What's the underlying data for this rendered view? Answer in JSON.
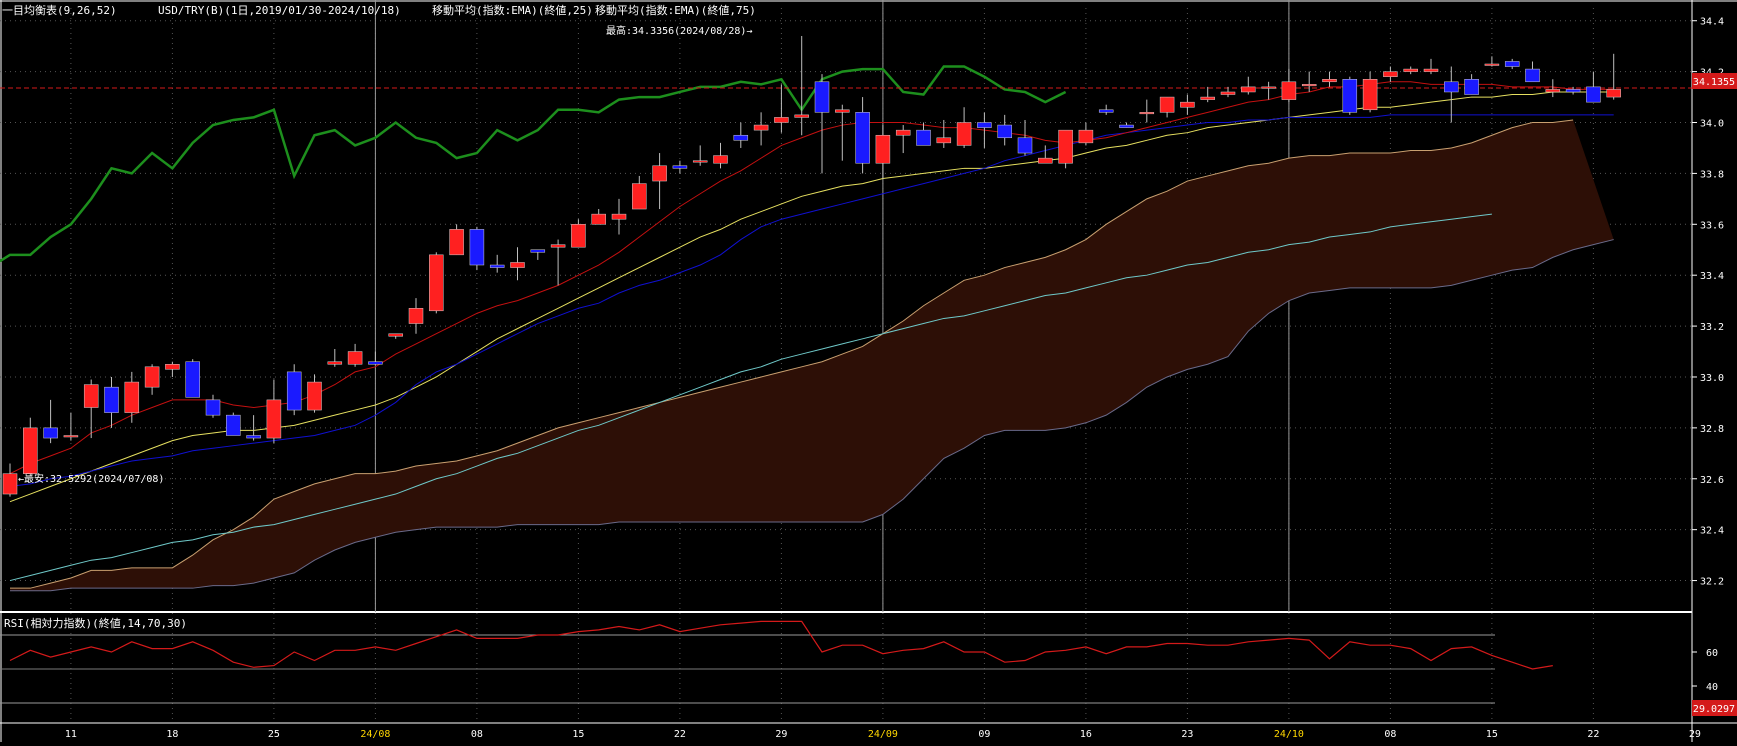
{
  "header": {
    "legend_ichimoku": "一目均衡表(9,26,52)",
    "legend_symbol": "USD/TRY(B)(1日,2019/01/30-2024/10/18)",
    "legend_ema25": "移動平均(指数:EMA)(終値,25)",
    "legend_ema75": "移動平均(指数:EMA)(終値,75)"
  },
  "annotations": {
    "high_label": "最高:34.3356(2024/08/28)→",
    "low_label": "←最安:32.5292(2024/07/08)",
    "last_price_tag": "34.1355",
    "rsi_value_tag": "29.0297"
  },
  "rsi_panel": {
    "title": "RSI(相対力指数)(終値,14,70,30)",
    "ticks": [
      "60",
      "40"
    ],
    "upper": 70,
    "mid": 50,
    "lower": 30
  },
  "colors": {
    "bg": "#000000",
    "up_candle": "#ff2020",
    "down_candle": "#1a1aff",
    "chikou": "#1d8f1d",
    "tenkan": "#c41010",
    "kijun": "#1010d0",
    "ema25": "#e6e060",
    "ema75": "#6fc9c9",
    "cloud": "#2d0f06",
    "last_line": "#d41a1a"
  },
  "chart_data": {
    "type": "candlestick",
    "ylim": [
      32.1,
      34.45
    ],
    "y_ticks": [
      "34.4",
      "34.2",
      "34.0",
      "33.8",
      "33.6",
      "33.4",
      "33.2",
      "33.0",
      "32.8",
      "32.6",
      "32.4",
      "32.2"
    ],
    "x_ticks": [
      {
        "label": "11",
        "highlight": false
      },
      {
        "label": "18",
        "highlight": false
      },
      {
        "label": "25",
        "highlight": false
      },
      {
        "label": "24/08",
        "highlight": true
      },
      {
        "label": "08",
        "highlight": false
      },
      {
        "label": "15",
        "highlight": false
      },
      {
        "label": "22",
        "highlight": false
      },
      {
        "label": "29",
        "highlight": false
      },
      {
        "label": "24/09",
        "highlight": true
      },
      {
        "label": "09",
        "highlight": false
      },
      {
        "label": "16",
        "highlight": false
      },
      {
        "label": "23",
        "highlight": false
      },
      {
        "label": "24/10",
        "highlight": true
      },
      {
        "label": "08",
        "highlight": false
      },
      {
        "label": "15",
        "highlight": false
      },
      {
        "label": "22",
        "highlight": false
      },
      {
        "label": "29",
        "highlight": false
      }
    ],
    "candles": [
      [
        32.54,
        32.66,
        32.53,
        32.62
      ],
      [
        32.62,
        32.84,
        32.61,
        32.8
      ],
      [
        32.8,
        32.91,
        32.74,
        32.76
      ],
      [
        32.77,
        32.86,
        32.75,
        32.77
      ],
      [
        32.88,
        32.99,
        32.76,
        32.97
      ],
      [
        32.96,
        33.0,
        32.8,
        32.86
      ],
      [
        32.86,
        33.02,
        32.82,
        32.98
      ],
      [
        32.96,
        33.05,
        32.93,
        33.04
      ],
      [
        33.03,
        33.06,
        33.0,
        33.05
      ],
      [
        33.06,
        33.07,
        32.97,
        32.92
      ],
      [
        32.91,
        32.93,
        32.84,
        32.85
      ],
      [
        32.85,
        32.86,
        32.78,
        32.77
      ],
      [
        32.77,
        32.85,
        32.75,
        32.76
      ],
      [
        32.76,
        32.99,
        32.74,
        32.91
      ],
      [
        33.02,
        33.05,
        32.85,
        32.87
      ],
      [
        32.87,
        33.01,
        32.86,
        32.98
      ],
      [
        33.05,
        33.11,
        33.04,
        33.06
      ],
      [
        33.05,
        33.13,
        33.04,
        33.1
      ],
      [
        33.06,
        33.1,
        33.05,
        33.05
      ],
      [
        33.16,
        33.17,
        33.15,
        33.17
      ],
      [
        33.21,
        33.31,
        33.17,
        33.27
      ],
      [
        33.26,
        33.49,
        33.25,
        33.48
      ],
      [
        33.48,
        33.6,
        33.48,
        33.58
      ],
      [
        33.58,
        33.59,
        33.42,
        33.44
      ],
      [
        33.44,
        33.48,
        33.41,
        33.43
      ],
      [
        33.43,
        33.51,
        33.38,
        33.45
      ],
      [
        33.5,
        33.5,
        33.46,
        33.49
      ],
      [
        33.51,
        33.54,
        33.36,
        33.52
      ],
      [
        33.51,
        33.62,
        33.53,
        33.6
      ],
      [
        33.6,
        33.66,
        33.61,
        33.64
      ],
      [
        33.62,
        33.7,
        33.56,
        33.64
      ],
      [
        33.66,
        33.79,
        33.66,
        33.76
      ],
      [
        33.77,
        33.88,
        33.66,
        33.83
      ],
      [
        33.83,
        33.85,
        33.8,
        33.82
      ],
      [
        33.85,
        33.91,
        33.83,
        33.85
      ],
      [
        33.84,
        33.92,
        33.82,
        33.87
      ],
      [
        33.95,
        34.0,
        33.9,
        33.93
      ],
      [
        33.97,
        34.04,
        33.91,
        33.99
      ],
      [
        34.0,
        34.15,
        33.96,
        34.02
      ],
      [
        34.02,
        34.34,
        33.95,
        34.03
      ],
      [
        34.16,
        34.19,
        33.8,
        34.04
      ],
      [
        34.04,
        34.07,
        33.85,
        34.05
      ],
      [
        34.04,
        34.1,
        33.8,
        33.84
      ],
      [
        33.84,
        33.99,
        33.78,
        33.95
      ],
      [
        33.95,
        33.99,
        33.88,
        33.97
      ],
      [
        33.97,
        34.0,
        33.92,
        33.91
      ],
      [
        33.92,
        34.01,
        33.9,
        33.94
      ],
      [
        33.91,
        34.06,
        33.9,
        34.0
      ],
      [
        34.0,
        34.04,
        33.9,
        33.98
      ],
      [
        33.99,
        34.03,
        33.91,
        33.94
      ],
      [
        33.94,
        34.01,
        33.87,
        33.88
      ],
      [
        33.84,
        33.91,
        33.84,
        33.86
      ],
      [
        33.84,
        33.93,
        33.82,
        33.97
      ],
      [
        33.92,
        34.0,
        33.91,
        33.97
      ],
      [
        34.05,
        34.07,
        34.03,
        34.04
      ],
      [
        33.99,
        34.0,
        33.98,
        33.98
      ],
      [
        34.04,
        34.09,
        34.0,
        34.04
      ],
      [
        34.04,
        34.1,
        34.02,
        34.1
      ],
      [
        34.06,
        34.11,
        34.03,
        34.08
      ],
      [
        34.09,
        34.14,
        34.08,
        34.1
      ],
      [
        34.11,
        34.14,
        34.1,
        34.12
      ],
      [
        34.12,
        34.18,
        34.11,
        34.14
      ],
      [
        34.14,
        34.16,
        34.09,
        34.14
      ],
      [
        34.09,
        34.21,
        34.08,
        34.16
      ],
      [
        34.15,
        34.2,
        34.12,
        34.15
      ],
      [
        34.16,
        34.2,
        34.14,
        34.17
      ],
      [
        34.17,
        34.18,
        34.03,
        34.04
      ],
      [
        34.05,
        34.2,
        34.04,
        34.17
      ],
      [
        34.18,
        34.22,
        34.16,
        34.2
      ],
      [
        34.2,
        34.22,
        34.19,
        34.21
      ],
      [
        34.2,
        34.25,
        34.19,
        34.21
      ],
      [
        34.16,
        34.22,
        34.0,
        34.12
      ],
      [
        34.17,
        34.19,
        34.11,
        34.11
      ],
      [
        34.23,
        34.26,
        34.22,
        34.23
      ],
      [
        34.24,
        34.25,
        34.21,
        34.22
      ],
      [
        34.21,
        34.24,
        34.17,
        34.16
      ],
      [
        34.12,
        34.17,
        34.1,
        34.13
      ],
      [
        34.13,
        34.14,
        34.11,
        34.12
      ],
      [
        34.14,
        34.2,
        34.08,
        34.08
      ],
      [
        34.1,
        34.27,
        34.09,
        34.13
      ]
    ],
    "tenkan": [
      32.62,
      32.66,
      32.69,
      32.72,
      32.78,
      32.81,
      32.85,
      32.88,
      32.91,
      32.91,
      32.91,
      32.89,
      32.88,
      32.89,
      32.9,
      32.93,
      32.97,
      33.02,
      33.04,
      33.09,
      33.13,
      33.17,
      33.21,
      33.25,
      33.28,
      33.3,
      33.33,
      33.36,
      33.4,
      33.44,
      33.49,
      33.55,
      33.61,
      33.67,
      33.72,
      33.77,
      33.81,
      33.86,
      33.91,
      33.94,
      33.97,
      33.99,
      34.0,
      34.0,
      34.0,
      33.99,
      33.98,
      33.98,
      33.97,
      33.96,
      33.95,
      33.93,
      33.92,
      33.93,
      33.94,
      33.96,
      33.98,
      34.0,
      34.02,
      34.04,
      34.06,
      34.08,
      34.09,
      34.11,
      34.12,
      34.14,
      34.14,
      34.15,
      34.16,
      34.16,
      34.15,
      34.15,
      34.15,
      34.15,
      34.14,
      34.14,
      34.14,
      34.13,
      34.13,
      34.13
    ],
    "kijun": [
      32.57,
      32.58,
      32.6,
      32.61,
      32.63,
      32.65,
      32.67,
      32.68,
      32.69,
      32.71,
      32.72,
      32.73,
      32.74,
      32.75,
      32.76,
      32.77,
      32.79,
      32.81,
      32.85,
      32.9,
      32.97,
      33.02,
      33.05,
      33.09,
      33.13,
      33.17,
      33.21,
      33.24,
      33.27,
      33.29,
      33.33,
      33.36,
      33.38,
      33.41,
      33.44,
      33.48,
      33.54,
      33.59,
      33.62,
      33.64,
      33.66,
      33.68,
      33.7,
      33.72,
      33.74,
      33.76,
      33.78,
      33.8,
      33.82,
      33.85,
      33.87,
      33.89,
      33.91,
      33.93,
      33.95,
      33.96,
      33.97,
      33.98,
      33.99,
      34.0,
      34.0,
      34.01,
      34.01,
      34.02,
      34.02,
      34.02,
      34.02,
      34.02,
      34.03,
      34.03,
      34.03,
      34.03,
      34.03,
      34.03,
      34.03,
      34.03,
      34.03,
      34.03,
      34.03,
      34.03
    ],
    "ema25": [
      32.51,
      32.54,
      32.57,
      32.6,
      32.63,
      32.66,
      32.69,
      32.72,
      32.75,
      32.77,
      32.78,
      32.79,
      32.79,
      32.8,
      32.81,
      32.83,
      32.85,
      32.87,
      32.89,
      32.92,
      32.96,
      33.0,
      33.05,
      33.1,
      33.15,
      33.19,
      33.23,
      33.27,
      33.31,
      33.35,
      33.39,
      33.43,
      33.47,
      33.51,
      33.55,
      33.58,
      33.62,
      33.65,
      33.68,
      33.71,
      33.73,
      33.75,
      33.76,
      33.78,
      33.79,
      33.8,
      33.81,
      33.82,
      33.82,
      33.83,
      33.84,
      33.85,
      33.86,
      33.88,
      33.9,
      33.91,
      33.93,
      33.95,
      33.96,
      33.98,
      33.99,
      34.0,
      34.01,
      34.02,
      34.03,
      34.04,
      34.05,
      34.06,
      34.06,
      34.07,
      34.08,
      34.09,
      34.1,
      34.1,
      34.11,
      34.11,
      34.12,
      34.12,
      34.12,
      34.12
    ],
    "ema75": [
      32.2,
      32.22,
      32.24,
      32.26,
      32.28,
      32.29,
      32.31,
      32.33,
      32.35,
      32.36,
      32.38,
      32.39,
      32.41,
      32.42,
      32.44,
      32.46,
      32.48,
      32.5,
      32.52,
      32.54,
      32.57,
      32.6,
      32.62,
      32.65,
      32.68,
      32.7,
      32.73,
      32.76,
      32.79,
      32.81,
      32.84,
      32.87,
      32.9,
      32.93,
      32.96,
      32.99,
      33.02,
      33.04,
      33.07,
      33.09,
      33.11,
      33.13,
      33.15,
      33.17,
      33.19,
      33.21,
      33.23,
      33.24,
      33.26,
      33.28,
      33.3,
      33.32,
      33.33,
      33.35,
      33.37,
      33.39,
      33.4,
      33.42,
      33.44,
      33.45,
      33.47,
      33.49,
      33.5,
      33.52,
      33.53,
      33.55,
      33.56,
      33.57,
      33.59,
      33.6,
      33.61,
      33.62,
      33.63,
      33.64
    ],
    "chikou": [
      33.43,
      33.48,
      33.48,
      33.55,
      33.6,
      33.7,
      33.82,
      33.8,
      33.88,
      33.82,
      33.92,
      33.99,
      34.01,
      34.02,
      34.05,
      33.79,
      33.95,
      33.97,
      33.91,
      33.94,
      34.0,
      33.94,
      33.92,
      33.86,
      33.88,
      33.97,
      33.93,
      33.97,
      34.05,
      34.05,
      34.04,
      34.09,
      34.1,
      34.1,
      34.12,
      34.14,
      34.14,
      34.16,
      34.15,
      34.17,
      34.05,
      34.17,
      34.2,
      34.21,
      34.21,
      34.12,
      34.11,
      34.22,
      34.22,
      34.18,
      34.13,
      34.12,
      34.08,
      34.12
    ],
    "senkou_a": [
      32.17,
      32.17,
      32.19,
      32.21,
      32.24,
      32.24,
      32.25,
      32.25,
      32.25,
      32.3,
      32.36,
      32.4,
      32.45,
      32.52,
      32.55,
      32.58,
      32.6,
      32.62,
      32.62,
      32.63,
      32.65,
      32.66,
      32.67,
      32.69,
      32.71,
      32.74,
      32.77,
      32.8,
      32.82,
      32.84,
      32.86,
      32.88,
      32.9,
      32.92,
      32.94,
      32.96,
      32.98,
      33.0,
      33.02,
      33.04,
      33.06,
      33.09,
      33.12,
      33.17,
      33.22,
      33.28,
      33.33,
      33.38,
      33.4,
      33.43,
      33.45,
      33.47,
      33.5,
      33.54,
      33.6,
      33.65,
      33.7,
      33.73,
      33.77,
      33.79,
      33.81,
      33.83,
      33.84,
      33.86,
      33.87,
      33.87,
      33.88,
      33.88,
      33.88,
      33.89,
      33.89,
      33.9,
      33.92,
      33.95,
      33.98,
      34.0,
      34.0,
      34.01
    ],
    "senkou_b": [
      32.16,
      32.16,
      32.16,
      32.17,
      32.17,
      32.17,
      32.17,
      32.17,
      32.17,
      32.17,
      32.18,
      32.18,
      32.19,
      32.21,
      32.23,
      32.28,
      32.32,
      32.35,
      32.37,
      32.39,
      32.4,
      32.41,
      32.41,
      32.41,
      32.41,
      32.42,
      32.42,
      32.42,
      32.42,
      32.42,
      32.43,
      32.43,
      32.43,
      32.43,
      32.43,
      32.43,
      32.43,
      32.43,
      32.43,
      32.43,
      32.43,
      32.43,
      32.43,
      32.46,
      32.52,
      32.6,
      32.68,
      32.72,
      32.77,
      32.79,
      32.79,
      32.79,
      32.8,
      32.82,
      32.85,
      32.9,
      32.96,
      33.0,
      33.03,
      33.05,
      33.08,
      33.18,
      33.25,
      33.3,
      33.33,
      33.34,
      33.35,
      33.35,
      33.35,
      33.35,
      33.35,
      33.36,
      33.38,
      33.4,
      33.42,
      33.43,
      33.47,
      33.5,
      33.52,
      33.54
    ],
    "rsi": [
      55,
      61,
      57,
      60,
      63,
      60,
      66,
      62,
      62,
      66,
      61,
      54,
      51,
      52,
      60,
      55,
      61,
      61,
      63,
      61,
      65,
      69,
      73,
      68,
      68,
      68,
      70,
      70,
      72,
      73,
      75,
      73,
      76,
      72,
      74,
      76,
      77,
      78,
      78,
      78,
      60,
      64,
      64,
      59,
      61,
      62,
      66,
      60,
      60,
      54,
      55,
      60,
      61,
      63,
      59,
      63,
      63,
      65,
      65,
      64,
      64,
      66,
      67,
      68,
      67,
      56,
      66,
      64,
      64,
      62,
      55,
      62,
      63,
      58,
      54,
      50,
      52
    ]
  }
}
